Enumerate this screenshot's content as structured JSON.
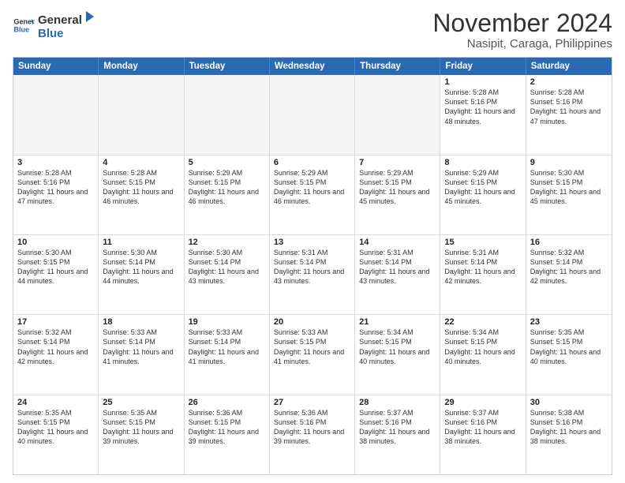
{
  "logo": {
    "general": "General",
    "blue": "Blue"
  },
  "title": "November 2024",
  "location": "Nasipit, Caraga, Philippines",
  "header_days": [
    "Sunday",
    "Monday",
    "Tuesday",
    "Wednesday",
    "Thursday",
    "Friday",
    "Saturday"
  ],
  "weeks": [
    [
      {
        "day": "",
        "sunrise": "",
        "sunset": "",
        "daylight": "",
        "empty": true
      },
      {
        "day": "",
        "sunrise": "",
        "sunset": "",
        "daylight": "",
        "empty": true
      },
      {
        "day": "",
        "sunrise": "",
        "sunset": "",
        "daylight": "",
        "empty": true
      },
      {
        "day": "",
        "sunrise": "",
        "sunset": "",
        "daylight": "",
        "empty": true
      },
      {
        "day": "",
        "sunrise": "",
        "sunset": "",
        "daylight": "",
        "empty": true
      },
      {
        "day": "1",
        "sunrise": "Sunrise: 5:28 AM",
        "sunset": "Sunset: 5:16 PM",
        "daylight": "Daylight: 11 hours and 48 minutes.",
        "empty": false
      },
      {
        "day": "2",
        "sunrise": "Sunrise: 5:28 AM",
        "sunset": "Sunset: 5:16 PM",
        "daylight": "Daylight: 11 hours and 47 minutes.",
        "empty": false
      }
    ],
    [
      {
        "day": "3",
        "sunrise": "Sunrise: 5:28 AM",
        "sunset": "Sunset: 5:16 PM",
        "daylight": "Daylight: 11 hours and 47 minutes.",
        "empty": false
      },
      {
        "day": "4",
        "sunrise": "Sunrise: 5:28 AM",
        "sunset": "Sunset: 5:15 PM",
        "daylight": "Daylight: 11 hours and 46 minutes.",
        "empty": false
      },
      {
        "day": "5",
        "sunrise": "Sunrise: 5:29 AM",
        "sunset": "Sunset: 5:15 PM",
        "daylight": "Daylight: 11 hours and 46 minutes.",
        "empty": false
      },
      {
        "day": "6",
        "sunrise": "Sunrise: 5:29 AM",
        "sunset": "Sunset: 5:15 PM",
        "daylight": "Daylight: 11 hours and 46 minutes.",
        "empty": false
      },
      {
        "day": "7",
        "sunrise": "Sunrise: 5:29 AM",
        "sunset": "Sunset: 5:15 PM",
        "daylight": "Daylight: 11 hours and 45 minutes.",
        "empty": false
      },
      {
        "day": "8",
        "sunrise": "Sunrise: 5:29 AM",
        "sunset": "Sunset: 5:15 PM",
        "daylight": "Daylight: 11 hours and 45 minutes.",
        "empty": false
      },
      {
        "day": "9",
        "sunrise": "Sunrise: 5:30 AM",
        "sunset": "Sunset: 5:15 PM",
        "daylight": "Daylight: 11 hours and 45 minutes.",
        "empty": false
      }
    ],
    [
      {
        "day": "10",
        "sunrise": "Sunrise: 5:30 AM",
        "sunset": "Sunset: 5:15 PM",
        "daylight": "Daylight: 11 hours and 44 minutes.",
        "empty": false
      },
      {
        "day": "11",
        "sunrise": "Sunrise: 5:30 AM",
        "sunset": "Sunset: 5:14 PM",
        "daylight": "Daylight: 11 hours and 44 minutes.",
        "empty": false
      },
      {
        "day": "12",
        "sunrise": "Sunrise: 5:30 AM",
        "sunset": "Sunset: 5:14 PM",
        "daylight": "Daylight: 11 hours and 43 minutes.",
        "empty": false
      },
      {
        "day": "13",
        "sunrise": "Sunrise: 5:31 AM",
        "sunset": "Sunset: 5:14 PM",
        "daylight": "Daylight: 11 hours and 43 minutes.",
        "empty": false
      },
      {
        "day": "14",
        "sunrise": "Sunrise: 5:31 AM",
        "sunset": "Sunset: 5:14 PM",
        "daylight": "Daylight: 11 hours and 43 minutes.",
        "empty": false
      },
      {
        "day": "15",
        "sunrise": "Sunrise: 5:31 AM",
        "sunset": "Sunset: 5:14 PM",
        "daylight": "Daylight: 11 hours and 42 minutes.",
        "empty": false
      },
      {
        "day": "16",
        "sunrise": "Sunrise: 5:32 AM",
        "sunset": "Sunset: 5:14 PM",
        "daylight": "Daylight: 11 hours and 42 minutes.",
        "empty": false
      }
    ],
    [
      {
        "day": "17",
        "sunrise": "Sunrise: 5:32 AM",
        "sunset": "Sunset: 5:14 PM",
        "daylight": "Daylight: 11 hours and 42 minutes.",
        "empty": false
      },
      {
        "day": "18",
        "sunrise": "Sunrise: 5:33 AM",
        "sunset": "Sunset: 5:14 PM",
        "daylight": "Daylight: 11 hours and 41 minutes.",
        "empty": false
      },
      {
        "day": "19",
        "sunrise": "Sunrise: 5:33 AM",
        "sunset": "Sunset: 5:14 PM",
        "daylight": "Daylight: 11 hours and 41 minutes.",
        "empty": false
      },
      {
        "day": "20",
        "sunrise": "Sunrise: 5:33 AM",
        "sunset": "Sunset: 5:15 PM",
        "daylight": "Daylight: 11 hours and 41 minutes.",
        "empty": false
      },
      {
        "day": "21",
        "sunrise": "Sunrise: 5:34 AM",
        "sunset": "Sunset: 5:15 PM",
        "daylight": "Daylight: 11 hours and 40 minutes.",
        "empty": false
      },
      {
        "day": "22",
        "sunrise": "Sunrise: 5:34 AM",
        "sunset": "Sunset: 5:15 PM",
        "daylight": "Daylight: 11 hours and 40 minutes.",
        "empty": false
      },
      {
        "day": "23",
        "sunrise": "Sunrise: 5:35 AM",
        "sunset": "Sunset: 5:15 PM",
        "daylight": "Daylight: 11 hours and 40 minutes.",
        "empty": false
      }
    ],
    [
      {
        "day": "24",
        "sunrise": "Sunrise: 5:35 AM",
        "sunset": "Sunset: 5:15 PM",
        "daylight": "Daylight: 11 hours and 40 minutes.",
        "empty": false
      },
      {
        "day": "25",
        "sunrise": "Sunrise: 5:35 AM",
        "sunset": "Sunset: 5:15 PM",
        "daylight": "Daylight: 11 hours and 39 minutes.",
        "empty": false
      },
      {
        "day": "26",
        "sunrise": "Sunrise: 5:36 AM",
        "sunset": "Sunset: 5:15 PM",
        "daylight": "Daylight: 11 hours and 39 minutes.",
        "empty": false
      },
      {
        "day": "27",
        "sunrise": "Sunrise: 5:36 AM",
        "sunset": "Sunset: 5:16 PM",
        "daylight": "Daylight: 11 hours and 39 minutes.",
        "empty": false
      },
      {
        "day": "28",
        "sunrise": "Sunrise: 5:37 AM",
        "sunset": "Sunset: 5:16 PM",
        "daylight": "Daylight: 11 hours and 38 minutes.",
        "empty": false
      },
      {
        "day": "29",
        "sunrise": "Sunrise: 5:37 AM",
        "sunset": "Sunset: 5:16 PM",
        "daylight": "Daylight: 11 hours and 38 minutes.",
        "empty": false
      },
      {
        "day": "30",
        "sunrise": "Sunrise: 5:38 AM",
        "sunset": "Sunset: 5:16 PM",
        "daylight": "Daylight: 11 hours and 38 minutes.",
        "empty": false
      }
    ]
  ]
}
